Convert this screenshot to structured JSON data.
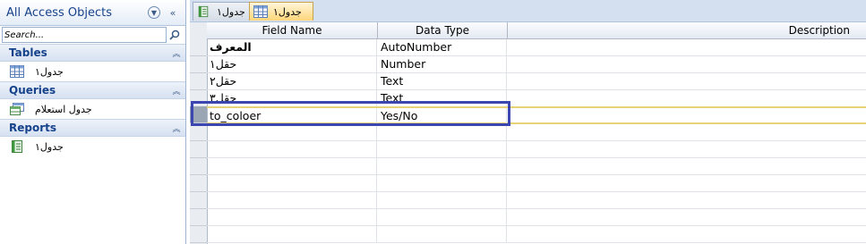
{
  "nav": {
    "title": "All Access Objects",
    "search_placeholder": "Search...",
    "groups": [
      {
        "title": "Tables",
        "items": [
          {
            "label": "جدول١",
            "icon": "table-icon"
          }
        ]
      },
      {
        "title": "Queries",
        "items": [
          {
            "label": "جدول استعلام",
            "icon": "query-icon"
          }
        ]
      },
      {
        "title": "Reports",
        "items": [
          {
            "label": "جدول١",
            "icon": "report-icon"
          }
        ]
      }
    ]
  },
  "tabs": [
    {
      "label": "جدول١",
      "icon": "report-icon",
      "active": false
    },
    {
      "label": "جدول١",
      "icon": "table-icon",
      "active": true
    }
  ],
  "grid": {
    "columns": [
      "Field Name",
      "Data Type",
      "Description"
    ],
    "rows": [
      {
        "field": "المعرف",
        "type": "AutoNumber",
        "description": ""
      },
      {
        "field": "حقل١",
        "type": "Number",
        "description": ""
      },
      {
        "field": "حقل٢",
        "type": "Text",
        "description": ""
      },
      {
        "field": "حقل٣",
        "type": "Text",
        "description": ""
      },
      {
        "field": "to_coloer",
        "type": "Yes/No",
        "description": ""
      }
    ]
  },
  "colors": {
    "accent": "#15428b",
    "highlight_box": "#3b46b0",
    "active_tab": "#ffd67a",
    "current_row_border": "#e8d37a"
  }
}
